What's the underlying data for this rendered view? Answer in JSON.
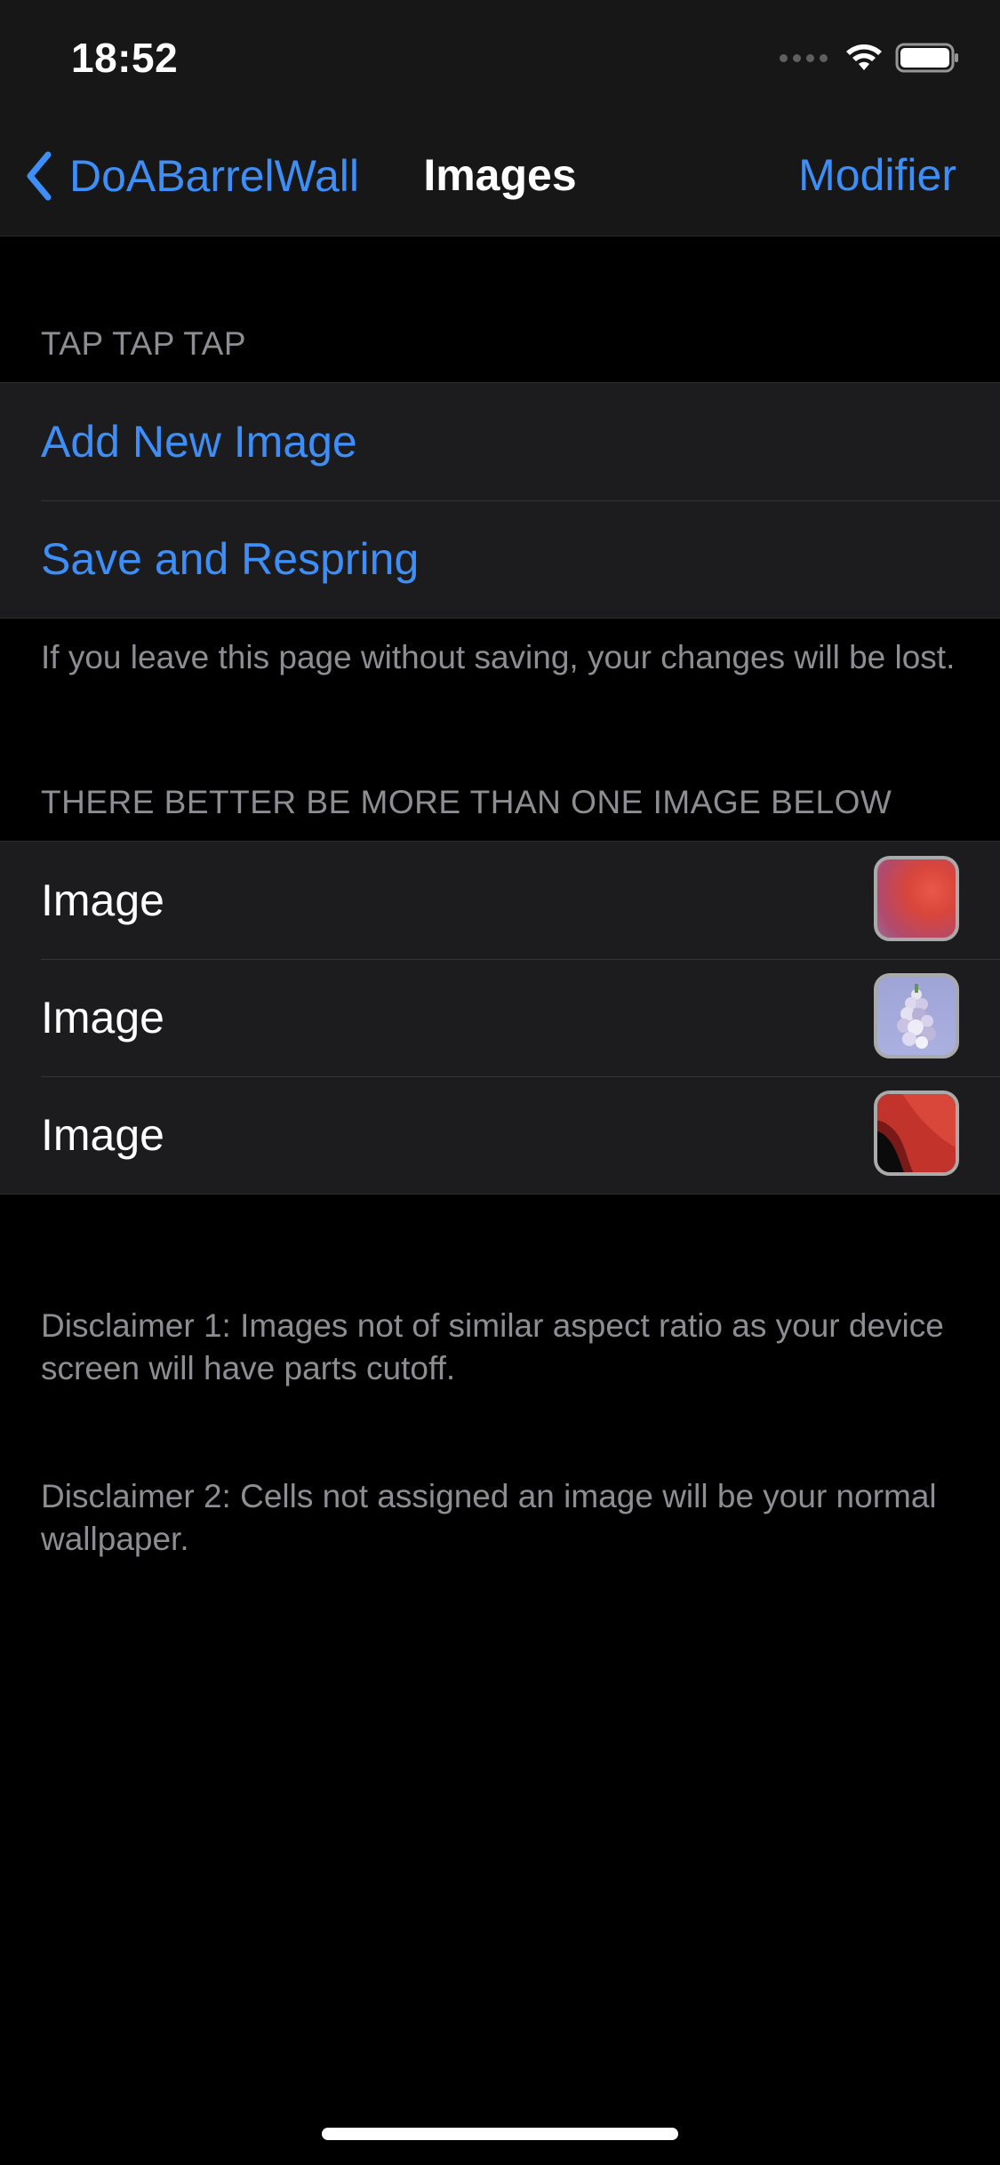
{
  "status_bar": {
    "time": "18:52"
  },
  "nav": {
    "back_label": "DoABarrelWall",
    "title": "Images",
    "action_label": "Modifier"
  },
  "actions_section": {
    "header": "TAP TAP TAP",
    "items": [
      {
        "label": "Add New Image"
      },
      {
        "label": "Save and Respring"
      }
    ],
    "footer": "If you leave this page without saving, your changes will be lost."
  },
  "images_section": {
    "header": "THERE BETTER BE MORE THAN ONE IMAGE BELOW",
    "items": [
      {
        "label": "Image",
        "thumbnail": "red-gradient-wallpaper-thumbnail"
      },
      {
        "label": "Image",
        "thumbnail": "lavender-flowers-thumbnail"
      },
      {
        "label": "Image",
        "thumbnail": "dark-red-wave-wallpaper-thumbnail"
      }
    ]
  },
  "disclaimers": [
    "Disclaimer 1: Images not of similar aspect ratio as your device screen will have parts cutoff.",
    "Disclaimer 2: Cells not assigned an image will be your normal wallpaper."
  ],
  "colors": {
    "accent": "#3d8ef7",
    "background": "#000000",
    "cell_background": "#1c1c1e",
    "secondary_text": "#8d8d93"
  }
}
